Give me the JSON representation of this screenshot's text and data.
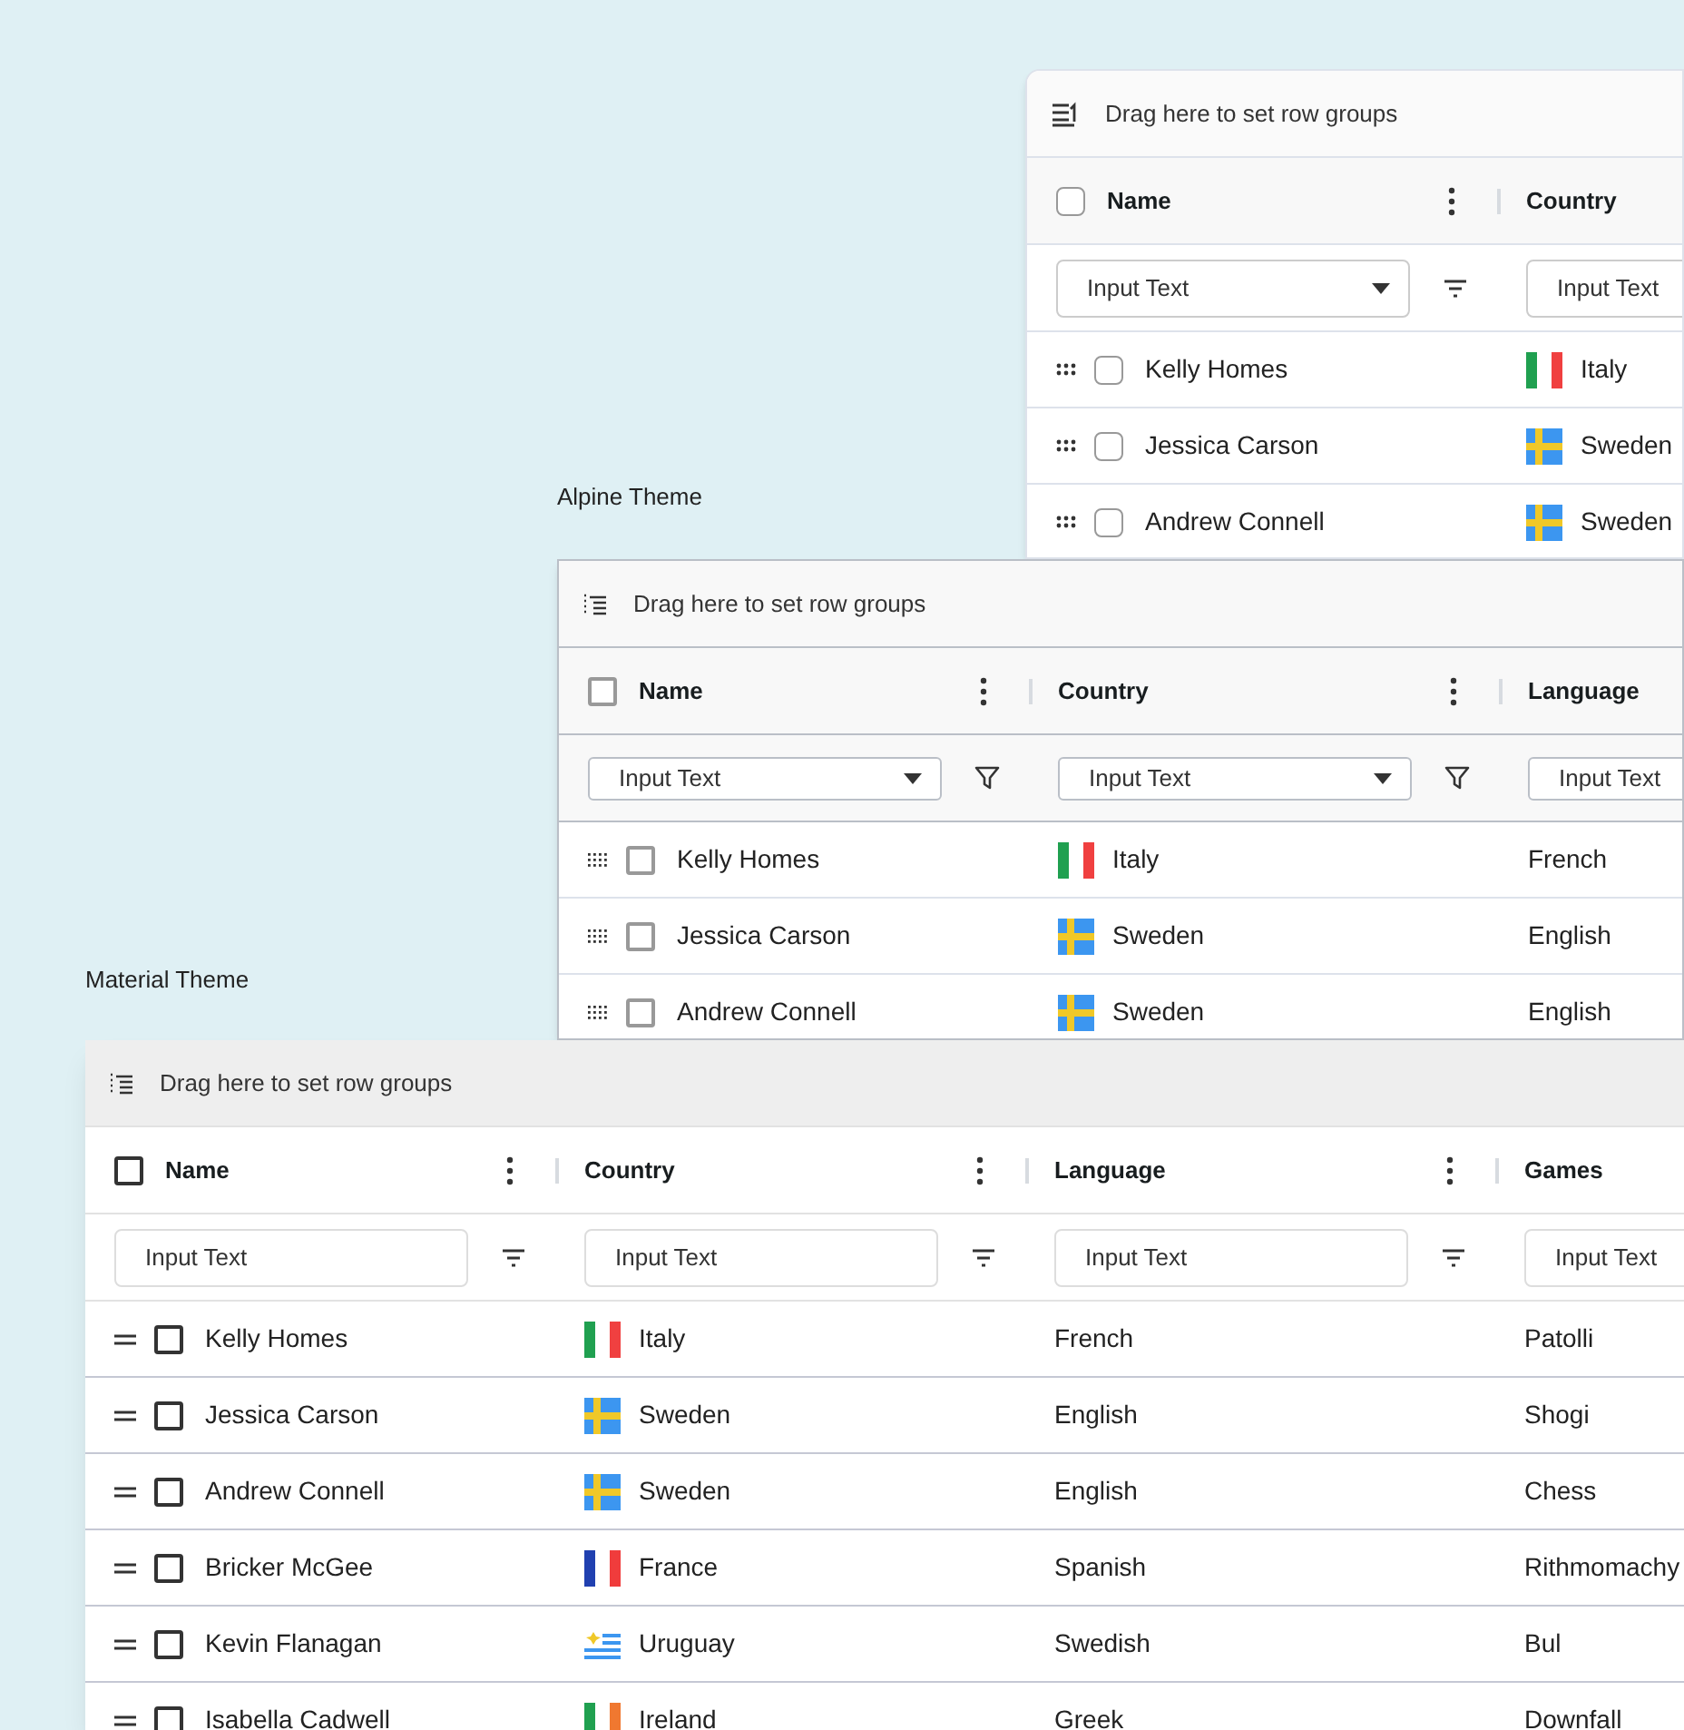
{
  "grids": [
    {
      "kind": "quartz",
      "group_bar": "Drag here to set row groups",
      "header_checked": false,
      "columns": [
        {
          "title": "Name",
          "filter": {
            "placeholder": "Input Text",
            "dropdown": true
          }
        },
        {
          "title": "Country",
          "filter": {
            "placeholder": "Input Text"
          }
        }
      ],
      "rows": [
        {
          "checked": false,
          "kind": "italy",
          "cells": [
            "Kelly Homes",
            "Italy"
          ]
        },
        {
          "checked": false,
          "kind": "sweden",
          "cells": [
            "Jessica Carson",
            "Sweden"
          ]
        },
        {
          "checked": false,
          "kind": "sweden",
          "cells": [
            "Andrew Connell",
            "Sweden"
          ]
        }
      ]
    },
    {
      "kind": "alpine",
      "label": "Alpine Theme",
      "group_bar": "Drag here to set row groups",
      "header_checked": false,
      "columns": [
        {
          "title": "Name",
          "filter": {
            "placeholder": "Input Text",
            "dropdown": true
          }
        },
        {
          "title": "Country",
          "filter": {
            "placeholder": "Input Text",
            "dropdown": true
          }
        },
        {
          "title": "Language",
          "filter": {
            "placeholder": "Input Text"
          }
        }
      ],
      "rows": [
        {
          "checked": false,
          "kind": "italy",
          "cells": [
            "Kelly Homes",
            "Italy",
            "French"
          ]
        },
        {
          "checked": false,
          "kind": "sweden",
          "cells": [
            "Jessica Carson",
            "Sweden",
            "English"
          ]
        },
        {
          "checked": false,
          "kind": "sweden",
          "cells": [
            "Andrew Connell",
            "Sweden",
            "English"
          ]
        }
      ]
    },
    {
      "kind": "material",
      "label": "Material Theme",
      "group_bar": "Drag here to set row groups",
      "header_checked": false,
      "columns": [
        {
          "title": "Name",
          "filter": {
            "placeholder": "Input Text",
            "dropdown": false
          }
        },
        {
          "title": "Country",
          "filter": {
            "placeholder": "Input Text",
            "dropdown": false
          }
        },
        {
          "title": "Language",
          "filter": {
            "placeholder": "Input Text",
            "dropdown": false
          }
        },
        {
          "title": "Games",
          "filter": {
            "placeholder": "Input Text"
          }
        }
      ],
      "rows": [
        {
          "checked": false,
          "kind": "italy",
          "cells": [
            "Kelly Homes",
            "Italy",
            "French",
            "Patolli"
          ]
        },
        {
          "checked": false,
          "kind": "sweden",
          "cells": [
            "Jessica Carson",
            "Sweden",
            "English",
            "Shogi"
          ]
        },
        {
          "checked": false,
          "kind": "sweden",
          "cells": [
            "Andrew Connell",
            "Sweden",
            "English",
            "Chess"
          ]
        },
        {
          "checked": false,
          "kind": "france",
          "cells": [
            "Bricker McGee",
            "France",
            "Spanish",
            "Rithmomachy"
          ]
        },
        {
          "checked": false,
          "kind": "uruguay",
          "cells": [
            "Kevin Flanagan",
            "Uruguay",
            "Swedish",
            "Bul"
          ]
        },
        {
          "checked": false,
          "kind": "ireland",
          "cells": [
            "Isabella Cadwell",
            "Ireland",
            "Greek",
            "Downfall"
          ]
        }
      ]
    }
  ]
}
